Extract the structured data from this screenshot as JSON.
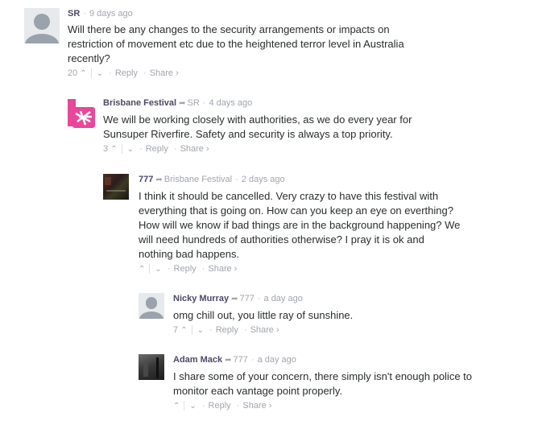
{
  "comments": [
    {
      "author": "SR",
      "parent": "",
      "time": "9 days ago",
      "text": "Will there be any changes to the security arrangements or impacts on restriction of movement etc due to the heightened terror level in Australia recently?",
      "votes": "20",
      "reply_label": "Reply",
      "share_label": "Share ›",
      "avatar": "default-avatar"
    },
    {
      "author": "Brisbane Festival",
      "parent": "SR",
      "time": "4 days ago",
      "text": "We will be working closely with authorities, as we do every year for Sunsuper Riverfire. Safety and security is always a top priority.",
      "votes": "3",
      "reply_label": "Reply",
      "share_label": "Share ›",
      "avatar": "brisbane-festival-logo",
      "brand_color": "#e8479a"
    },
    {
      "author": "777",
      "parent": "Brisbane Festival",
      "time": "2 days ago",
      "text": "I think it should be cancelled. Very crazy to have this festival with everything that is going on. How can you keep an eye on everthing? How will we know if bad things are in the background happening? We will need hundreds of authorities otherwise? I pray it is ok and nothing bad happens.",
      "votes": "",
      "reply_label": "Reply",
      "share_label": "Share ›",
      "avatar": "photo-avatar"
    },
    {
      "author": "Nicky Murray",
      "parent": "777",
      "time": "a day ago",
      "text": "omg chill out, you little ray of sunshine.",
      "votes": "7",
      "reply_label": "Reply",
      "share_label": "Share ›",
      "avatar": "default-avatar"
    },
    {
      "author": "Adam Mack",
      "parent": "777",
      "time": "a day ago",
      "text": "I share some of your concern, there simply isn't enough police to monitor each vantage point properly.",
      "votes": "",
      "reply_label": "Reply",
      "share_label": "Share ›",
      "avatar": "photo-avatar-bw"
    }
  ],
  "icons": {
    "upvote": "^",
    "downvote": "v",
    "reply_arrow": "➦",
    "separator": "·"
  }
}
